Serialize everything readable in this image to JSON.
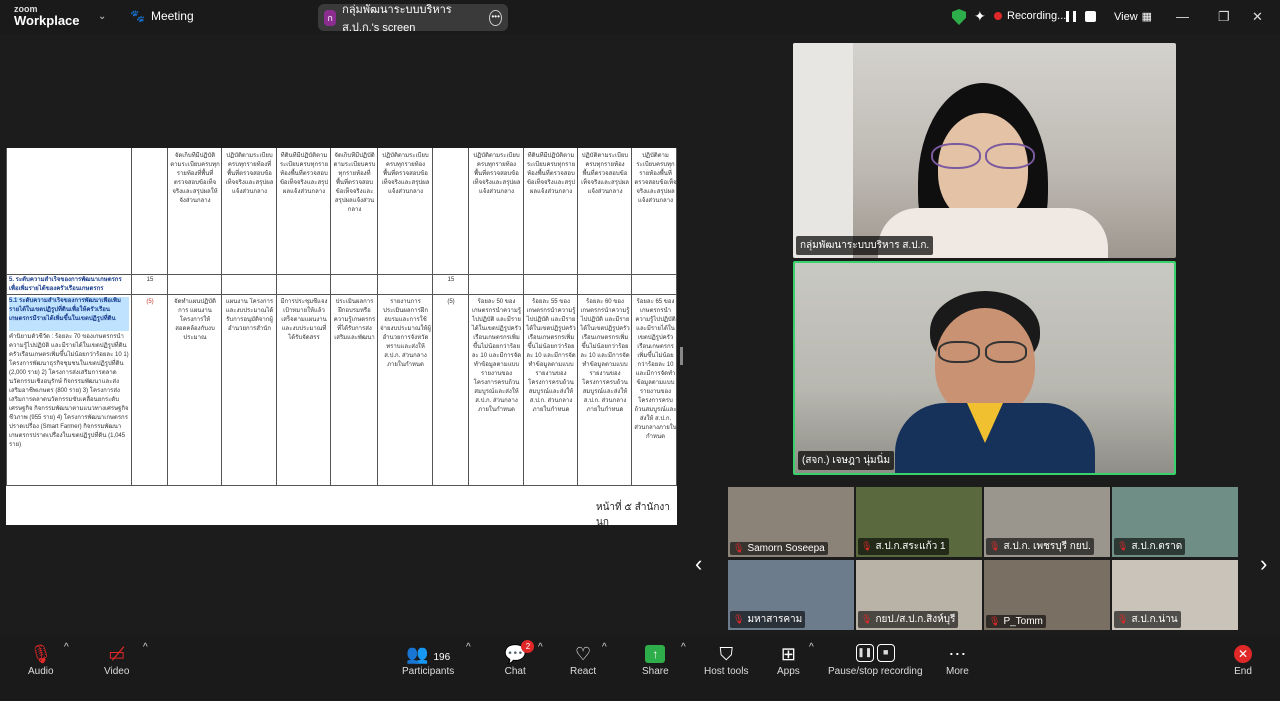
{
  "topbar": {
    "brand_line1": "zoom",
    "brand_line2": "Workplace",
    "meeting_label": "Meeting",
    "share_badge": "ก",
    "share_title": "กลุ่มพัฒนาระบบบริหาร ส.ป.ก.'s screen",
    "recording_label": "Recording...",
    "view_label": "View"
  },
  "document": {
    "header_cells": [
      "จัดเก็บที่มีปฏิบัติตามระเบียบครบทุกรายท้องที่พื้นที่ตรวจสอบข้อเท็จจริงและสรุปผลให้จังส่วนกลาง",
      "ปฏิบัติตามระเบียบครบทุกรายท้องที่พื้นที่ตรวจสอบข้อเท็จจริงและสรุปผลแจ้งส่วนกลาง",
      "ที่ดินที่มีปฏิบัติตามระเบียบครบทุกรายท้องพื้นที่ตรวจสอบข้อเท็จจริงและสรุปผลแจ้งส่วนกลาง",
      "จัดเก็บที่มีปฏิบัติตามระเบียบครบทุกรายท้องที่พื้นที่ตรวจสอบข้อเท็จจริงและสรุปผลแจ้งส่วนกลาง",
      "ปฏิบัติตามระเบียบครบทุกรายท้องพื้นที่ตรวจสอบข้อเท็จจริงและสรุปผลแจ้งส่วนกลาง",
      "ปฏิบัติตามระเบียบครบทุกรายท้องพื้นที่ตรวจสอบข้อเท็จจริงและสรุปผลแจ้งส่วนกลาง",
      "ที่ดินที่มีปฏิบัติตามระเบียบครบทุกรายท้องพื้นที่ตรวจสอบข้อเท็จจริงและสรุปผลแจ้งส่วนกลาง",
      "ปฏิบัติตามระเบียบครบทุกรายท้องพื้นที่ตรวจสอบข้อเท็จจริงและสรุปผลแจ้งส่วนกลาง",
      "ปฏิบัติตามระเบียบครบทุกรายท้องพื้นที่ตรวจสอบข้อเท็จจริงและสรุปผลแจ้งส่วนกลาง"
    ],
    "section_title": "5. ระดับความสำเร็จของการพัฒนาเกษตรกรเพื่อเพิ่มรายได้ของครัวเรือนเกษตรกร",
    "section_value1": "15",
    "section_value2": "15",
    "highlight_text": "5.1 ระดับความสำเร็จของการพัฒนาเพื่อเพิ่มรายได้ในเขตปฏิรูปที่ดินเพื่อให้ครัวเรือนเกษตรกรมีรายได้เพิ่มขึ้นในเขตปฏิรูปที่ดิน",
    "body_text": "คำนิยามตัวชี้วัด : ร้อยละ 70 ของเกษตรกรนำความรู้ไปปฏิบัติ และมีรายได้ในเขตปฏิรูปที่ดินครัวเรือนเกษตรเพิ่มขึ้นไม่น้อยกว่าร้อยละ 10 1) โครงการพัฒนาธุรกิจชุมชนในเขตปฏิรูปที่ดิน (2,000 ราย) 2) โครงการส่งเสริมการตลาดนวัตกรรมเชิงอนุรักษ์ กิจกรรมพัฒนาและส่งเสริมอาชีพเกษตร (800 ราย) 3) โครงการส่งเสริมการตลาดนวัตกรรมขับเคลื่อนยกระดับเศรษฐกิจ กิจกรรมพัฒนาตามแนวทางเศรษฐกิจชีวภาพ (955 ราย) 4) โครงการพัฒนาเกษตรกรปราดเปรื่อง (Smart Farmer) กิจกรรมพัฒนาเกษตรกรปราดเปรื่องในเขตปฏิรูปที่ดิน (1,045 ราย)",
    "weight": "(5)",
    "weight2": "(5)",
    "row_cells": [
      "จัดทำแผนปฏิบัติการ แผนงาน โครงการให้สอดคล้องกับงบประมาณ",
      "แผนงาน โครงการ และงบประมาณได้รับการอนุมัติจากผู้อำนวยการสำนัก",
      "มีการประชุมชี้แจงเป้าหมายให้แล้วเสร็จตามแผนงานและงบประมาณที่ได้รับจัดสรร",
      "ประเมินผลการฝึกอบรมหรือความรู้เกษตรกรที่ได้รับการส่งเสริมและพัฒนา",
      "รายงานการประเมินผลการฝึกอบรมและการใช้จ่ายงบประมาณให้ผู้อำนวยการจังหวัดทราบและส่งให้ ส.ป.ก. ส่วนกลางภายในกำหนด",
      "ร้อยละ 50 ของเกษตรกรนำความรู้ไปปฏิบัติ และมีรายได้ในเขตปฏิรูปครัวเรือนเกษตรกรเพิ่มขึ้นไม่น้อยกว่าร้อยละ 10 และมีการจัดทำข้อมูลตามแบบรายงานของโครงการครบถ้วนสมบูรณ์และส่งให้ ส.ป.ก. ส่วนกลางภายในกำหนด",
      "ร้อยละ 55 ของเกษตรกรนำความรู้ไปปฏิบัติ และมีรายได้ในเขตปฏิรูปครัวเรือนเกษตรกรเพิ่มขึ้นไม่น้อยกว่าร้อยละ 10 และมีการจัดทำข้อมูลตามแบบรายงานของโครงการครบถ้วนสมบูรณ์และส่งให้ ส.ป.ก. ส่วนกลางภายในกำหนด",
      "ร้อยละ 60 ของเกษตรกรนำความรู้ไปปฏิบัติ และมีรายได้ในเขตปฏิรูปครัวเรือนเกษตรกรเพิ่มขึ้นไม่น้อยกว่าร้อยละ 10 และมีการจัดทำข้อมูลตามแบบรายงานของโครงการครบถ้วนสมบูรณ์และส่งให้ ส.ป.ก. ส่วนกลางภายในกำหนด",
      "ร้อยละ 65 ของเกษตรกรนำความรู้ไปปฏิบัติ และมีรายได้ในเขตปฏิรูปครัวเรือนเกษตรกรเพิ่มขึ้นไม่น้อยกว่าร้อยละ 10 และมีการจัดทำข้อมูลตามแบบรายงานของโครงการครบถ้วนสมบูรณ์และส่งให้ ส.ป.ก. ส่วนกลางภายในกำหนด"
    ],
    "footer": "หน้าที่ ๕ สำนักงานก"
  },
  "videos": {
    "top_name": "กลุ่มพัฒนาระบบบริหาร ส.ป.ก.",
    "bottom_name": "(สจก.) เจษฎา นุ่มนิ่ม"
  },
  "thumbnails": [
    {
      "name": "Samorn Soseepa",
      "bg": "#8b8378"
    },
    {
      "name": "ส.ป.ก.สระแก้ว 1",
      "bg": "#5b6a3e"
    },
    {
      "name": "ส.ป.ก. เพชรบุรี กยป.",
      "bg": "#9a958d"
    },
    {
      "name": "ส.ป.ก.ตราด",
      "bg": "#6f8f86"
    },
    {
      "name": "มหาสารคาม",
      "bg": "#6d7c8c"
    },
    {
      "name": "กยป./ส.ป.ก.สิงห์บุรี",
      "bg": "#b9b2a6"
    },
    {
      "name": "P_Tomm",
      "bg": "#7a6f63"
    },
    {
      "name": "ส.ป.ก.น่าน",
      "bg": "#c9c3ba"
    }
  ],
  "toolbar": {
    "audio": "Audio",
    "video": "Video",
    "participants_count": "196",
    "participants": "Participants",
    "chat_badge": "2",
    "chat": "Chat",
    "react": "React",
    "share": "Share",
    "host_tools": "Host tools",
    "apps": "Apps",
    "pause_stop": "Pause/stop recording",
    "more": "More",
    "end": "End"
  },
  "colors": {
    "accent_green": "#2eae4a",
    "active_speaker_border": "#38d26a",
    "danger_red": "#e02828"
  }
}
